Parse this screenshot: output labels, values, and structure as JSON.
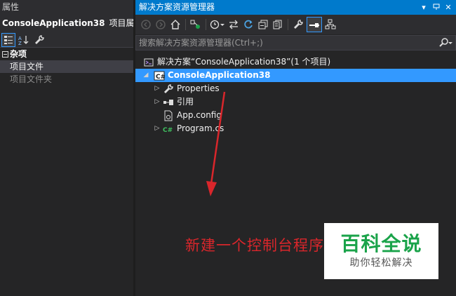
{
  "properties_panel": {
    "title": "属性",
    "object_name": "ConsoleApplication38",
    "object_kind": "项目属性",
    "category": "杂项",
    "rows": [
      {
        "label": "项目文件"
      },
      {
        "label": "项目文件夹"
      }
    ],
    "toolbar_icons": [
      "categorized-icon",
      "alphabetical-icon",
      "wrench-icon"
    ]
  },
  "solution_explorer": {
    "title": "解决方案资源管理器",
    "title_controls": [
      "▾",
      "▭",
      "✕"
    ],
    "search_placeholder": "搜索解决方案资源管理器(Ctrl+;)",
    "tree": {
      "solution": "解决方案“ConsoleApplication38”(1 个项目)",
      "project": "ConsoleApplication38",
      "project_badge": "C#",
      "items": [
        {
          "label": "Properties",
          "icon": "wrench-icon",
          "expandable": true
        },
        {
          "label": "引用",
          "icon": "references-icon",
          "expandable": true
        },
        {
          "label": "App.config",
          "icon": "config-file-icon",
          "expandable": false
        },
        {
          "label": "Program.cs",
          "icon": "csharp-file-icon",
          "expandable": true
        }
      ]
    }
  },
  "annotation": {
    "text": "新建一个控制台程序",
    "color": "#d9262b"
  },
  "watermark": {
    "title": "百科全说",
    "subtitle": "助你轻松解决"
  },
  "colors": {
    "accent": "#007acc",
    "selection": "#3399ff",
    "background": "#252526"
  }
}
